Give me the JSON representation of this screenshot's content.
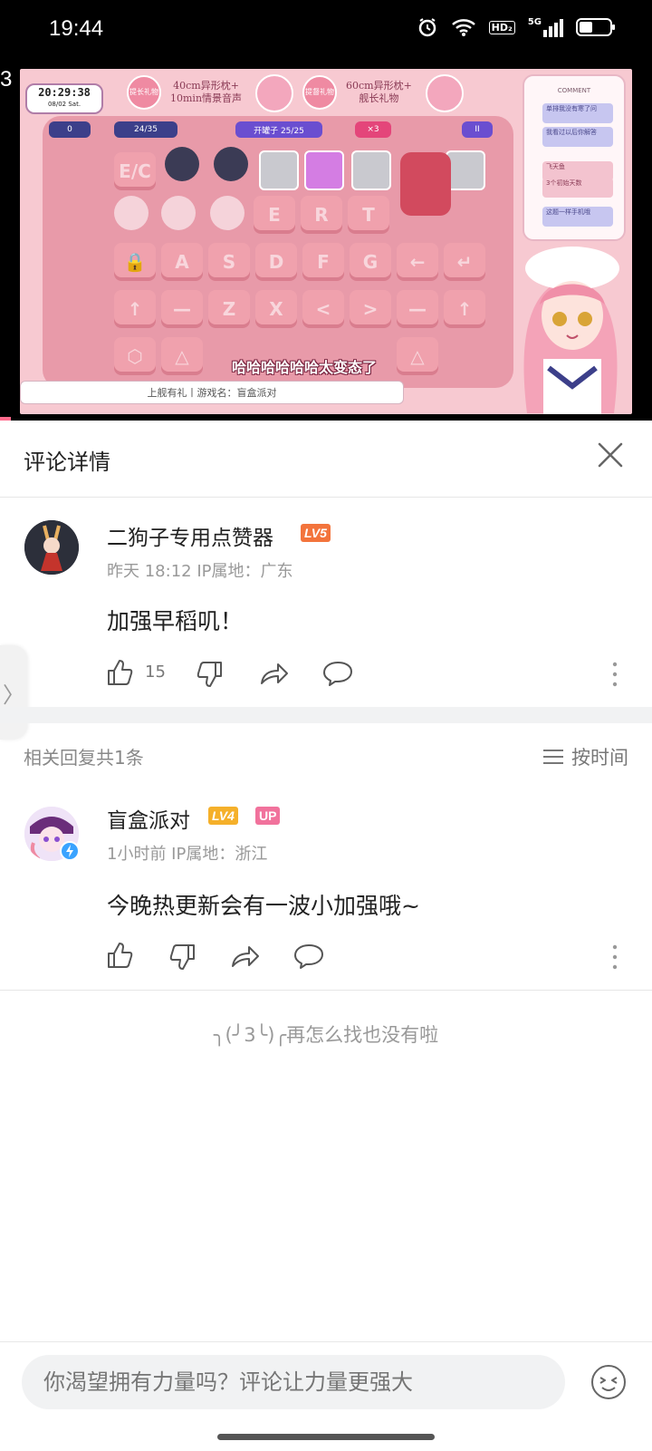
{
  "status": {
    "time": "19:44",
    "hd": "HD₂",
    "net": "5G"
  },
  "video": {
    "side_number": "3",
    "clock_time": "20:29:38",
    "clock_date": "08/02 Sat.",
    "promo1_badge": "提长礼物",
    "promo1_text": "40cm异形枕+\n10min情景音声",
    "promo2_badge": "提督礼物",
    "promo2_text": "60cm异形枕+\n舰长礼物",
    "hud_score": "0",
    "hud_count": "24/35",
    "hud_stage": "开罐子 25/25",
    "hud_multiplier": "×3",
    "hud_pause": "II",
    "keys_row1": [
      "E",
      "R",
      "T"
    ],
    "keys_row2": [
      "A",
      "S",
      "D",
      "F",
      "G",
      "←",
      "↵"
    ],
    "keys_row3": [
      "↑",
      "—",
      "Z",
      "X",
      "<",
      ">",
      "—",
      "↑"
    ],
    "subtitle": "哈哈哈哈哈哈太变态了",
    "search_text": "上舰有礼丨游戏名：盲盒派对",
    "panel_title": "COMMENT",
    "chat": [
      "单排我没有寒了问",
      "我看过以后你解答",
      "飞天鱼",
      "3个初始天数",
      "这题一样手机哦"
    ]
  },
  "header": {
    "title": "评论详情"
  },
  "main_comment": {
    "username": "二狗子专用点赞器",
    "level": "LV5",
    "meta": "昨天 18:12 IP属地：广东",
    "text": "加强早稻叽！",
    "likes": "15"
  },
  "replies_header": {
    "title": "相关回复共1条",
    "sort_label": "按时间"
  },
  "reply": {
    "username": "盲盒派对",
    "level": "LV4",
    "up_badge": "UP",
    "meta": "1小时前 IP属地：浙江",
    "text": "今晚热更新会有一波小加强哦~"
  },
  "end_text": "╮(╯3╰)╭再怎么找也没有啦",
  "input": {
    "placeholder": "你渴望拥有力量吗？评论让力量更强大"
  },
  "side_tab": {
    "glyph": "〉"
  },
  "colors": {
    "lv5": "#f3743c",
    "lv4": "#f5b02a",
    "up": "#f1729c",
    "accent": "#fb7299"
  }
}
